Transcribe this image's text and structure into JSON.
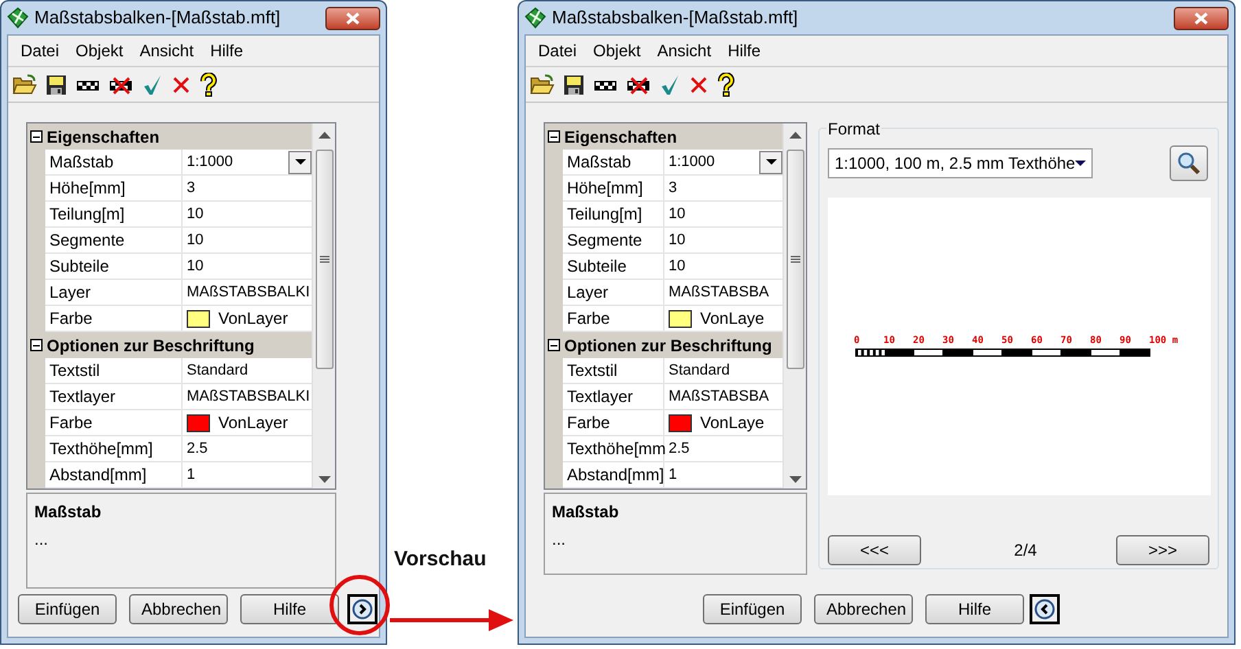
{
  "windows": [
    {
      "title": "Maßstabsbalken-[Maßstab.mft]",
      "menu": [
        "Datei",
        "Objekt",
        "Ansicht",
        "Hilfe"
      ],
      "grid": {
        "categories": [
          {
            "title": "Eigenschaften",
            "expanded": true,
            "rows": [
              {
                "label": "Maßstab",
                "value": "1:1000",
                "kind": "dropdown"
              },
              {
                "label": "Höhe[mm]",
                "value": "3",
                "kind": "text"
              },
              {
                "label": "Teilung[m]",
                "value": "10",
                "kind": "text"
              },
              {
                "label": "Segmente",
                "value": "10",
                "kind": "text"
              },
              {
                "label": "Subteile",
                "value": "10",
                "kind": "text"
              },
              {
                "label": "Layer",
                "value": "MAßSTABSBALKI",
                "kind": "text"
              },
              {
                "label": "Farbe",
                "value": "VonLayer",
                "kind": "color",
                "color": "#ffff80"
              }
            ]
          },
          {
            "title": "Optionen zur Beschriftung",
            "expanded": true,
            "rows": [
              {
                "label": "Textstil",
                "value": "Standard",
                "kind": "text"
              },
              {
                "label": "Textlayer",
                "value": "MAßSTABSBALKI",
                "kind": "text"
              },
              {
                "label": "Farbe",
                "value": "VonLayer",
                "kind": "color",
                "color": "#ff0000"
              },
              {
                "label": "Texthöhe[mm]",
                "value": "2.5",
                "kind": "text"
              },
              {
                "label": "Abstand[mm]",
                "value": "1",
                "kind": "text"
              }
            ]
          }
        ]
      },
      "description": {
        "title": "Maßstab",
        "text": "..."
      },
      "buttons": [
        "Einfügen",
        "Abbrechen",
        "Hilfe"
      ],
      "toggle": {
        "kind": "expand"
      }
    },
    {
      "title": "Maßstabsbalken-[Maßstab.mft]",
      "menu": [
        "Datei",
        "Objekt",
        "Ansicht",
        "Hilfe"
      ],
      "grid": {
        "categories": [
          {
            "title": "Eigenschaften",
            "expanded": true,
            "rows": [
              {
                "label": "Maßstab",
                "value": "1:1000",
                "kind": "dropdown"
              },
              {
                "label": "Höhe[mm]",
                "value": "3",
                "kind": "text"
              },
              {
                "label": "Teilung[m]",
                "value": "10",
                "kind": "text"
              },
              {
                "label": "Segmente",
                "value": "10",
                "kind": "text"
              },
              {
                "label": "Subteile",
                "value": "10",
                "kind": "text"
              },
              {
                "label": "Layer",
                "value": "MAßSTABSBA",
                "kind": "text"
              },
              {
                "label": "Farbe",
                "value": "VonLaye",
                "kind": "color",
                "color": "#ffff80"
              }
            ]
          },
          {
            "title": "Optionen zur Beschriftung",
            "expanded": true,
            "rows": [
              {
                "label": "Textstil",
                "value": "Standard",
                "kind": "text"
              },
              {
                "label": "Textlayer",
                "value": "MAßSTABSBA",
                "kind": "text"
              },
              {
                "label": "Farbe",
                "value": "VonLaye",
                "kind": "color",
                "color": "#ff0000"
              },
              {
                "label": "Texthöhe[mm",
                "value": "2.5",
                "kind": "text"
              },
              {
                "label": "Abstand[mm]",
                "value": "1",
                "kind": "text"
              }
            ]
          }
        ]
      },
      "description": {
        "title": "Maßstab",
        "text": "..."
      },
      "preview": {
        "group_label": "Format",
        "format": "1:1000, 100 m, 2.5 mm Texthöhe",
        "scale_labels": [
          "0",
          "10",
          "20",
          "30",
          "40",
          "50",
          "60",
          "70",
          "80",
          "90",
          "100 m"
        ],
        "prev_button": "<<<",
        "page": "2/4",
        "next_button": ">>>"
      },
      "buttons": [
        "Einfügen",
        "Abbrechen",
        "Hilfe"
      ],
      "toggle": {
        "kind": "collapse"
      }
    }
  ],
  "annotation": {
    "label": "Vorschau"
  }
}
